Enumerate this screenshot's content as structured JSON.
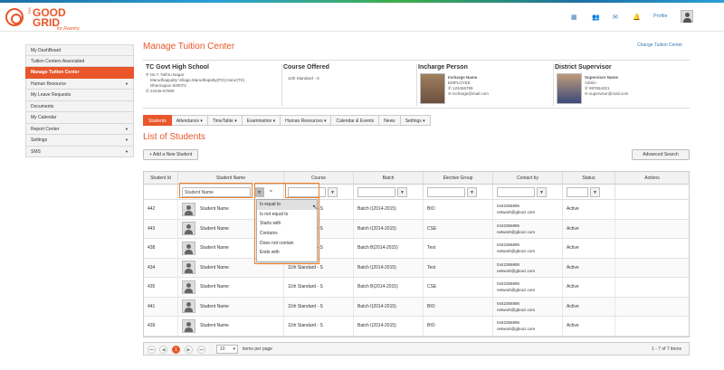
{
  "brand": {
    "the": "THE",
    "good": "GOOD",
    "grid": "GRID",
    "tag": "for Roentry"
  },
  "header": {
    "profile_label": "Profile"
  },
  "sidebar": {
    "items": [
      {
        "label": "My DashBoard",
        "active": false,
        "arrow": false
      },
      {
        "label": "Tuition Centers Associated",
        "active": false,
        "arrow": false
      },
      {
        "label": "Manage Tuition Center",
        "active": true,
        "arrow": false
      },
      {
        "label": "Human Resource",
        "active": false,
        "arrow": true
      },
      {
        "label": "My Leave Requests",
        "active": false,
        "arrow": false
      },
      {
        "label": "Documents",
        "active": false,
        "arrow": false
      },
      {
        "label": "My Calendar",
        "active": false,
        "arrow": false
      },
      {
        "label": "Report Center",
        "active": false,
        "arrow": true
      },
      {
        "label": "Settings",
        "active": false,
        "arrow": true
      },
      {
        "label": "SMS",
        "active": false,
        "arrow": true
      }
    ]
  },
  "page": {
    "title": "Manage Tuition Center",
    "change_link": "Change Tuition Center",
    "list_title": "List of Students"
  },
  "center": {
    "name": "TC Govt High School",
    "addr1": "No:7, Nehru Nagar",
    "addr2": "Marudhappatty Village,Marudhapatty(PO),Harur(TK)",
    "addr3": "Dharmapuri 600072",
    "phone": "22345-67890"
  },
  "course": {
    "heading": "Course Offered",
    "value": "11th Standard - S"
  },
  "incharge": {
    "heading": "Incharge Person",
    "name": "Incharge Name",
    "role": "EMPLOYEE",
    "phone": "123456789",
    "email": "incharge@mail.com"
  },
  "supervisor": {
    "heading": "District Supervisor",
    "name": "Supervisor Name",
    "role": "Admin",
    "phone": "987654321",
    "email": "supervisor@mail.com"
  },
  "tabs": [
    {
      "label": "Students",
      "active": true
    },
    {
      "label": "Attendance ▾",
      "active": false
    },
    {
      "label": "TimeTable ▾",
      "active": false
    },
    {
      "label": "Examination ▾",
      "active": false
    },
    {
      "label": "Human Resources ▾",
      "active": false
    },
    {
      "label": "Calendar & Events",
      "active": false
    },
    {
      "label": "News",
      "active": false
    },
    {
      "label": "Settings ▾",
      "active": false
    }
  ],
  "buttons": {
    "add": "+ Add a New Student",
    "advanced": "Advanced Search"
  },
  "grid": {
    "headers": [
      "Student Id",
      "Student Name",
      "Course",
      "Batch",
      "Elective Group",
      "Contact by",
      "Status",
      "Actions"
    ],
    "filter_value": "Student Name",
    "rows": [
      {
        "id": "442",
        "name": "Student Name",
        "course": "11th Standard - S",
        "batch": "Batch I(2014-2015)",
        "elective": "BIO",
        "phone": "0442356895",
        "email": "network@gboxz.com",
        "status": "Active"
      },
      {
        "id": "443",
        "name": "Student Name",
        "course": "11th Standard - S",
        "batch": "Batch I(2014-2015)",
        "elective": "CSE",
        "phone": "0442356895",
        "email": "network@gboxz.com",
        "status": "Active"
      },
      {
        "id": "438",
        "name": "Student Name",
        "course": "11th Standard - S",
        "batch": "Batch B(2014-2015)",
        "elective": "Test",
        "phone": "0442356895",
        "email": "network@gboxz.com",
        "status": "Active"
      },
      {
        "id": "434",
        "name": "Student Name",
        "course": "11th Standard - S",
        "batch": "Batch I(2014-2015)",
        "elective": "Test",
        "phone": "0442356895",
        "email": "network@gboxz.com",
        "status": "Active"
      },
      {
        "id": "435",
        "name": "Student Name",
        "course": "11th Standard - S",
        "batch": "Batch B(2014-2015)",
        "elective": "CSE",
        "phone": "0442356895",
        "email": "network@gboxz.com",
        "status": "Active"
      },
      {
        "id": "441",
        "name": "Student Name",
        "course": "11th Standard - S",
        "batch": "Batch I(2014-2015)",
        "elective": "BIO",
        "phone": "0442356895",
        "email": "network@gboxz.com",
        "status": "Active"
      },
      {
        "id": "439",
        "name": "Student Name",
        "course": "11th Standard - S",
        "batch": "Batch I(2014-2015)",
        "elective": "BIO",
        "phone": "0442356895",
        "email": "network@gboxz.com",
        "status": "Active"
      }
    ]
  },
  "filter_menu": {
    "options": [
      "Is equal to",
      "Is not equal to",
      "Starts with",
      "Contains",
      "Does not contain",
      "Ends with"
    ],
    "selected": 0
  },
  "pager": {
    "current": "1",
    "page_size": "10",
    "items_label": "items per page",
    "summary": "1 - 7 of 7 items"
  },
  "colors": {
    "accent": "#e8562a",
    "link": "#3a78b5",
    "highlight": "#f0802a"
  }
}
